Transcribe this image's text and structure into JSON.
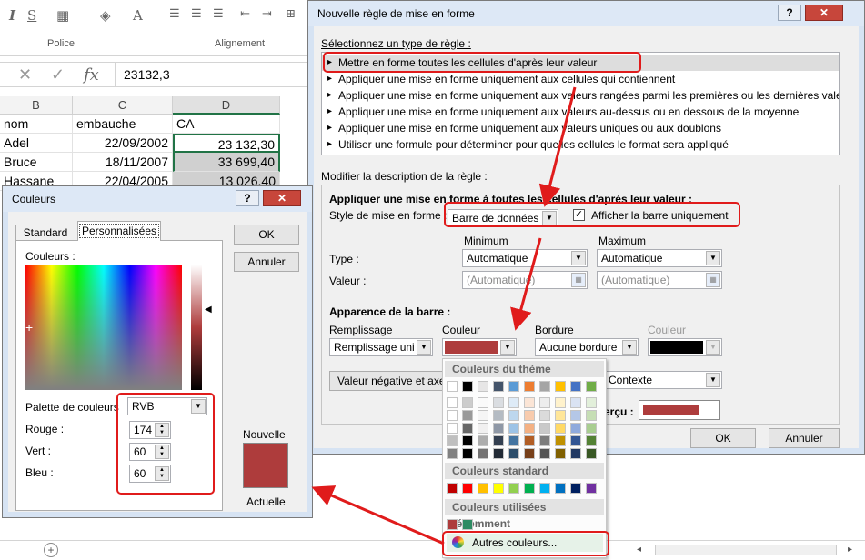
{
  "ribbon": {
    "group_police": "Police",
    "group_alignement": "Alignement",
    "btn_s": "S",
    "btn_a": "A"
  },
  "formula": {
    "value": "23132,3",
    "fx": "fx"
  },
  "grid": {
    "columns": [
      "B",
      "C",
      "D"
    ],
    "headers": {
      "b": "nom",
      "c": "embauche",
      "d": "CA"
    },
    "rows": [
      {
        "b": "Adel",
        "c": "22/09/2002",
        "d": "23 132,30"
      },
      {
        "b": "Bruce",
        "c": "18/11/2007",
        "d": "33 699,40"
      },
      {
        "b": "Hassane",
        "c": "22/04/2005",
        "d": "13 026,40"
      }
    ]
  },
  "rule_dialog": {
    "title": "Nouvelle règle de mise en forme",
    "select_type_label": "Sélectionnez un type de règle :",
    "rule_types": [
      "Mettre en forme toutes les cellules d'après leur valeur",
      "Appliquer une mise en forme uniquement aux cellules qui contiennent",
      "Appliquer une mise en forme uniquement aux valeurs rangées parmi les premières ou les dernières valeurs",
      "Appliquer une mise en forme uniquement aux valeurs au-dessus ou en dessous de la moyenne",
      "Appliquer une mise en forme uniquement aux valeurs uniques ou aux doublons",
      "Utiliser une formule pour déterminer pour quelles cellules le format sera appliqué"
    ],
    "modify_label": "Modifier la description de la règle :",
    "apply_heading": "Appliquer une mise en forme à toutes les cellules d'après leur valeur :",
    "style_label": "Style de mise en forme :",
    "style_value": "Barre de données",
    "show_bar_only": "Afficher la barre uniquement",
    "minimum": "Minimum",
    "maximum": "Maximum",
    "type_label": "Type :",
    "type_min": "Automatique",
    "type_max": "Automatique",
    "valeur_label": "Valeur :",
    "valeur_min": "(Automatique)",
    "valeur_max": "(Automatique)",
    "appearance": "Apparence de la barre :",
    "remplissage_label": "Remplissage",
    "remplissage_value": "Remplissage uni",
    "couleur_label": "Couleur",
    "bordure_label": "Bordure",
    "bordure_value": "Aucune bordure",
    "couleur2_label": "Couleur",
    "negative_btn": "Valeur négative et axe",
    "contexte_value": "Contexte",
    "apercu_label": "erçu :",
    "ok": "OK",
    "cancel": "Annuler"
  },
  "palette": {
    "theme_title": "Couleurs du thème",
    "standard_title": "Couleurs standard",
    "recent_title": "Couleurs utilisées récemment",
    "more_colors": "Autres couleurs...",
    "theme_top": [
      "#ffffff",
      "#000000",
      "#e7e6e6",
      "#44546a",
      "#5b9bd5",
      "#ed7d31",
      "#a5a5a5",
      "#ffc000",
      "#4472c4",
      "#70ad47"
    ],
    "standard": [
      "#c00000",
      "#ff0000",
      "#ffc000",
      "#ffff00",
      "#92d050",
      "#00b050",
      "#00b0f0",
      "#0070c0",
      "#002060",
      "#7030a0"
    ],
    "recent": [
      "#ae3c3c",
      "#2e8b63"
    ]
  },
  "colors_dialog": {
    "title": "Couleurs",
    "tab_standard": "Standard",
    "tab_custom": "Personnalisées",
    "colors_label": "Couleurs :",
    "model_label": "Palette de couleurs",
    "model_value": "RVB",
    "red_label": "Rouge :",
    "green_label": "Vert :",
    "blue_label": "Bleu :",
    "red": "174",
    "green": "60",
    "blue": "60",
    "new_label": "Nouvelle",
    "current_label": "Actuelle",
    "ok": "OK",
    "cancel": "Annuler",
    "selected_color": "#ae3c3c"
  }
}
